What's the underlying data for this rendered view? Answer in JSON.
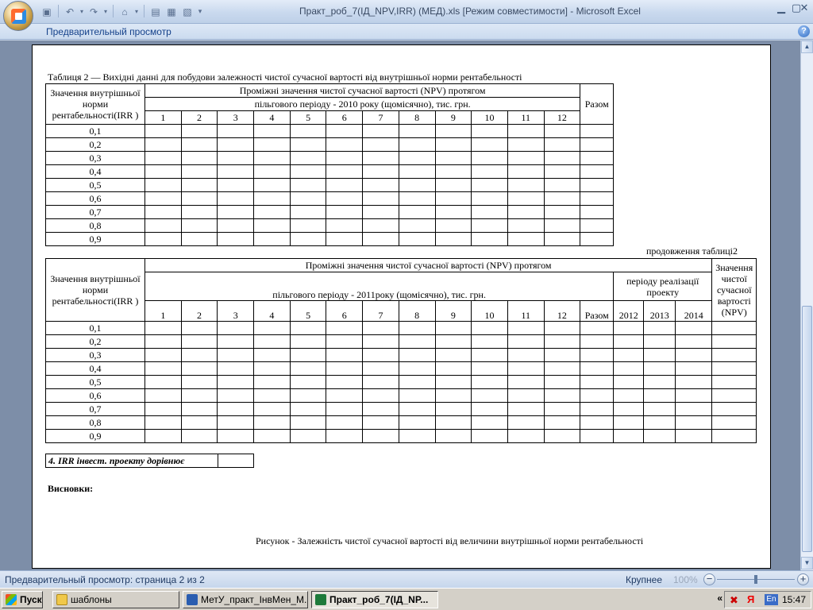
{
  "window": {
    "title": "Практ_роб_7(ІД_NPV,IRR) (МЕД).xls  [Режим совместимости] - Microsoft Excel",
    "ribbon_tab": "Предварительный просмотр",
    "help": "?"
  },
  "qat": [
    "save-icon",
    "undo-icon",
    "redo-icon",
    "format-painter-icon",
    "table-icon",
    "grid-icon",
    "print-preview-icon"
  ],
  "document": {
    "caption": "Таблиця 2 — Вихідні данні для побудови залежності чистої сучасної вартості від внутрішньої норми рентабельності",
    "table1": {
      "irr_header": "Значення внутрішньої норми рентабельності(IRR )",
      "group_header": "Проміжні значення чистої сучасної вартості (NPV) протягом",
      "period_header": "пільгового періоду - 2010 року (щомісячно), тис. грн.",
      "total_header": "Разом",
      "months": [
        "1",
        "2",
        "3",
        "4",
        "5",
        "6",
        "7",
        "8",
        "9",
        "10",
        "11",
        "12"
      ],
      "rows": [
        "0,1",
        "0,2",
        "0,3",
        "0,4",
        "0,5",
        "0,6",
        "0,7",
        "0,8",
        "0,9"
      ]
    },
    "continuation": "продовження таблиці2",
    "table2": {
      "irr_header": "Значення внутрішньої норми рентабельності(IRR )",
      "group_header": "Проміжні значення чистої сучасної вартості (NPV) протягом",
      "period_header": "пільгового періоду - 2011року (щомісячно), тис. грн.",
      "realization_header": "періоду реалізації проекту",
      "npv_header": "Значення чистої сучасної вартості (NPV)",
      "total_header": "Разом",
      "months": [
        "1",
        "2",
        "3",
        "4",
        "5",
        "6",
        "7",
        "8",
        "9",
        "10",
        "11",
        "12"
      ],
      "years": [
        "2012",
        "2013",
        "2014"
      ],
      "rows": [
        "0,1",
        "0,2",
        "0,3",
        "0,4",
        "0,5",
        "0,6",
        "0,7",
        "0,8",
        "0,9"
      ]
    },
    "irr_label": "4. IRR інвест. проекту дорівнює",
    "conclusions": "Висновки:",
    "figure_caption": "Рисунок - Залежність  чистої сучасної вартості від величини внутрішньої норми рентабельності"
  },
  "statusbar": {
    "text": "Предварительный просмотр: страница 2 из 2",
    "zoom_label": "Крупнее",
    "zoom_pct": "100%"
  },
  "taskbar": {
    "start": "Пуск",
    "items": [
      {
        "label": "шаблоны"
      },
      {
        "label": "МетУ_практ_ІнвМен_М..."
      },
      {
        "label": "Практ_роб_7(ІД_NP..."
      }
    ],
    "lang": "En",
    "clock": "15:47"
  }
}
